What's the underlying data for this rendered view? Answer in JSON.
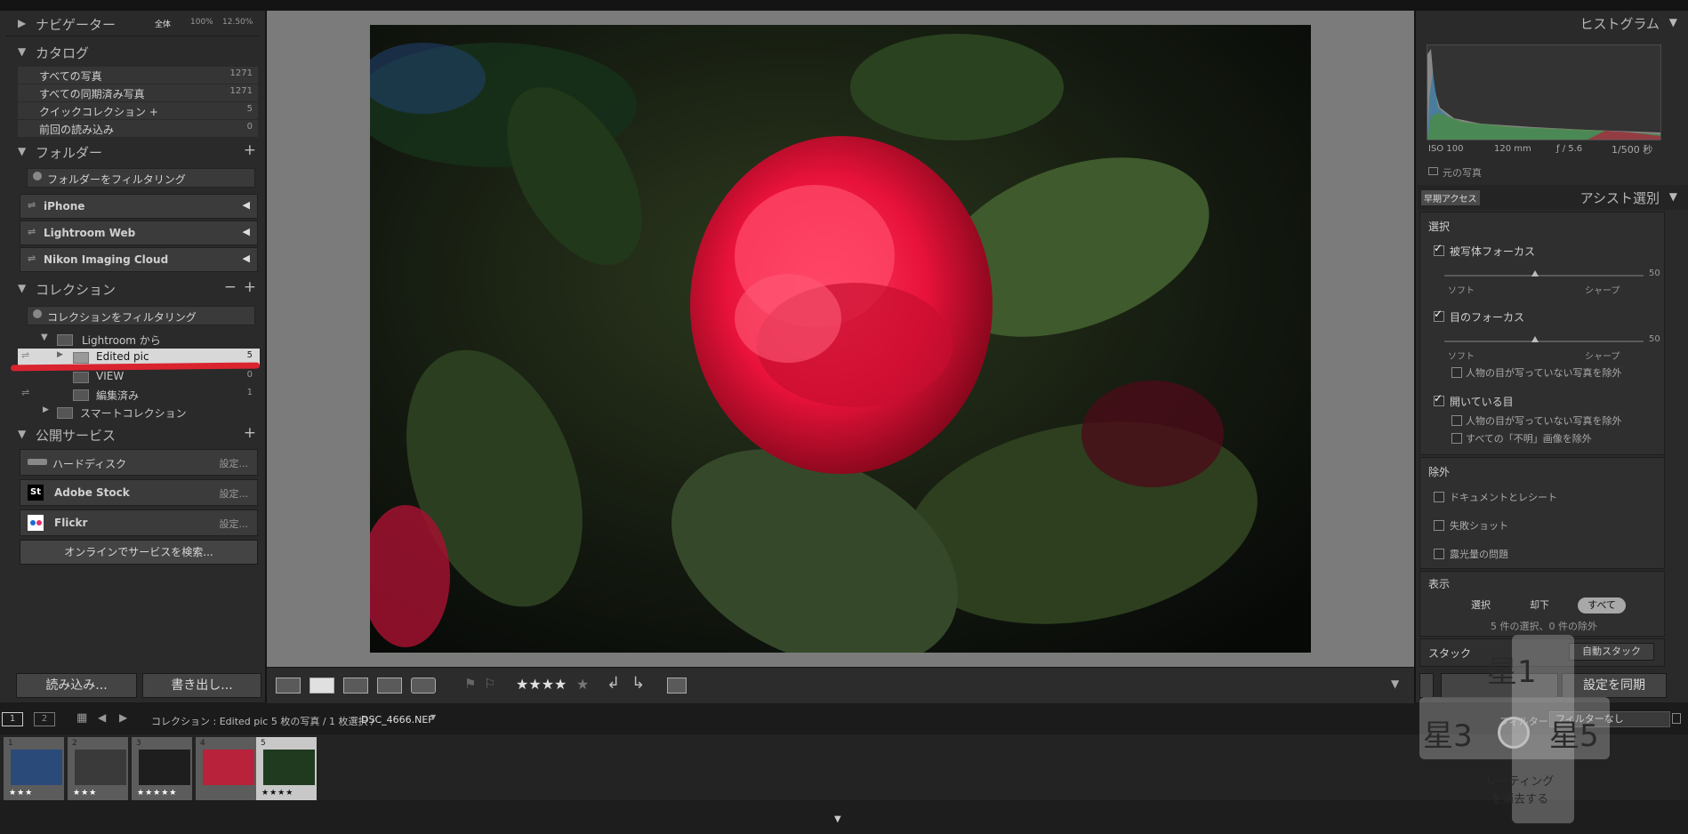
{
  "navigator": {
    "title": "ナビゲーター",
    "zoom_fit": "全体",
    "zoom_100": "100%",
    "zoom_custom": "12.50%"
  },
  "catalog": {
    "title": "カタログ",
    "items": [
      {
        "label": "すべての写真",
        "count": "1271"
      },
      {
        "label": "すべての同期済み写真",
        "count": "1271"
      },
      {
        "label": "クイックコレクション +",
        "count": "5"
      },
      {
        "label": "前回の読み込み",
        "count": "0"
      }
    ]
  },
  "folders": {
    "title": "フォルダー",
    "filter_placeholder": "フォルダーをフィルタリング",
    "volumes": [
      {
        "label": "iPhone"
      },
      {
        "label": "Lightroom Web"
      },
      {
        "label": "Nikon Imaging Cloud"
      }
    ]
  },
  "collections": {
    "title": "コレクション",
    "filter_placeholder": "コレクションをフィルタリング",
    "items": [
      {
        "label": "Lightroom から",
        "count": ""
      },
      {
        "label": "Edited pic",
        "count": "5"
      },
      {
        "label": "VIEW",
        "count": "0"
      },
      {
        "label": "編集済み",
        "count": "1"
      },
      {
        "label": "スマートコレクション",
        "count": ""
      }
    ]
  },
  "publish": {
    "title": "公開サービス",
    "services": [
      {
        "label": "ハードディスク",
        "settings": "設定..."
      },
      {
        "label": "Adobe Stock",
        "settings": "設定..."
      },
      {
        "label": "Flickr",
        "settings": "設定..."
      }
    ],
    "find_online": "オンラインでサービスを検索..."
  },
  "left_buttons": {
    "import": "読み込み...",
    "export": "書き出し..."
  },
  "toolbar": {
    "rating_stars": "★★★★",
    "rating_empty": "★"
  },
  "filmstrip_bar": {
    "page1": "1",
    "page2": "2",
    "path": "コレクション : Edited pic  5 枚の写真 / 1 枚選択 /",
    "filename": "DSC_4666.NEF",
    "filter_label": "フィルター :",
    "filter_value": "フィルターなし"
  },
  "thumbnails": [
    {
      "num": "1",
      "stars": "★★★",
      "color": "#2a4a7a"
    },
    {
      "num": "2",
      "stars": "★★★",
      "color": "#3a3a3a"
    },
    {
      "num": "3",
      "stars": "★★★★★",
      "color": "#1e1e1e"
    },
    {
      "num": "4",
      "stars": "",
      "color": "#b8223a"
    },
    {
      "num": "5",
      "stars": "★★★★",
      "color": "#1f3a1f"
    }
  ],
  "histogram": {
    "title": "ヒストグラム",
    "iso": "ISO 100",
    "focal": "120 mm",
    "aperture": "ƒ / 5.6",
    "shutter": "1/500 秒",
    "original_label": "元の写真"
  },
  "assist": {
    "early_access": "早期アクセス",
    "title": "アシスト選別",
    "select_title": "選択",
    "subject_focus": "被写体フォーカス",
    "eye_focus": "目のフォーカス",
    "soft": "ソフト",
    "sharp": "シャープ",
    "value": "50",
    "exclude_no_eyes_1": "人物の目が写っていない写真を除外",
    "open_eyes": "開いている目",
    "exclude_no_eyes_2": "人物の目が写っていない写真を除外",
    "exclude_unknown": "すべての「不明」画像を除外",
    "exclude_title": "除外",
    "documents": "ドキュメントとレシート",
    "failed": "失敗ショット",
    "exposure": "露光量の問題",
    "display_title": "表示",
    "show_select": "選択",
    "show_reject": "却下",
    "show_all": "すべて",
    "summary": "5 件の選択、0 件の除外",
    "stack_title": "スタック",
    "auto_stack": "自動スタック",
    "sync_settings": "設定を同期"
  },
  "overlay": {
    "star1": "星1",
    "star3": "星3",
    "star5": "星5",
    "clear_rating": "レーティング\nを消去する"
  }
}
